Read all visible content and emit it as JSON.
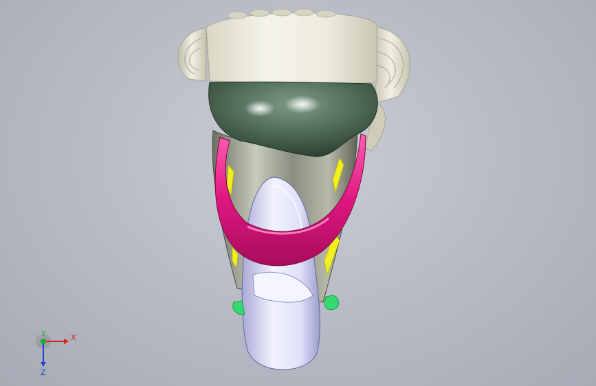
{
  "viewport": {
    "background": "#b9bdc7"
  },
  "model": {
    "parts": [
      {
        "name": "top-cap",
        "color": "#e9e7d6"
      },
      {
        "name": "rim-band",
        "color": "#4e6a56"
      },
      {
        "name": "body-shell",
        "color": "#8f9486"
      },
      {
        "name": "pink-strap",
        "color": "#d9157a"
      },
      {
        "name": "front-tongue",
        "color": "#d9daf3"
      },
      {
        "name": "yellow-ribs",
        "color": "#f2ef1c"
      },
      {
        "name": "green-clips",
        "color": "#35d96f"
      }
    ]
  },
  "triad": {
    "x_label": "X",
    "y_label": "Y",
    "z_label": "Z",
    "x_color": "#e02020",
    "y_color": "#1faa2a",
    "z_color": "#2040d0"
  }
}
